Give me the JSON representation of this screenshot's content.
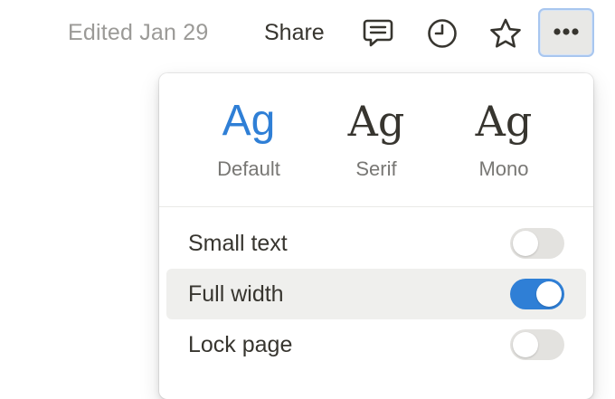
{
  "topbar": {
    "edited_text": "Edited Jan 29",
    "share_label": "Share",
    "icons": [
      "comments-icon",
      "history-clock-icon",
      "favorite-star-icon",
      "more-options-icon"
    ]
  },
  "menu": {
    "font_options": [
      {
        "sample": "Ag",
        "name": "Default",
        "selected": true
      },
      {
        "sample": "Ag",
        "name": "Serif",
        "selected": false
      },
      {
        "sample": "Ag",
        "name": "Mono",
        "selected": false
      }
    ],
    "settings": [
      {
        "label": "Small text",
        "enabled": false
      },
      {
        "label": "Full width",
        "enabled": true
      },
      {
        "label": "Lock page",
        "enabled": false
      }
    ]
  },
  "colors": {
    "accent": "#2f7fd6",
    "text": "#37352f",
    "muted": "#9b9a97",
    "toggle_off": "#e3e2df",
    "hover_row": "#efefed"
  }
}
